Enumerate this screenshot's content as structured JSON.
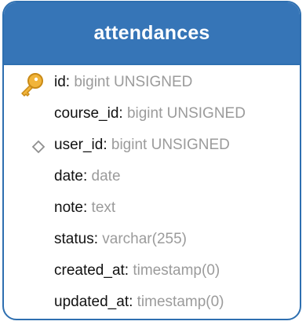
{
  "table": {
    "title": "attendances",
    "fields": [
      {
        "name": "id",
        "type": "bigint UNSIGNED",
        "icon": "primary-key-icon"
      },
      {
        "name": "course_id",
        "type": "bigint UNSIGNED",
        "icon": ""
      },
      {
        "name": "user_id",
        "type": "bigint UNSIGNED",
        "icon": "foreign-key-diamond-icon"
      },
      {
        "name": "date",
        "type": "date",
        "icon": ""
      },
      {
        "name": "note",
        "type": "text",
        "icon": ""
      },
      {
        "name": "status",
        "type": "varchar(255)",
        "icon": ""
      },
      {
        "name": "created_at",
        "type": "timestamp(0)",
        "icon": ""
      },
      {
        "name": "updated_at",
        "type": "timestamp(0)",
        "icon": ""
      }
    ]
  },
  "colors": {
    "header": "#3675b7",
    "border": "#2e6fb0",
    "key": "#e8a52b",
    "type_text": "#9b9b9b"
  },
  "separator": ":"
}
